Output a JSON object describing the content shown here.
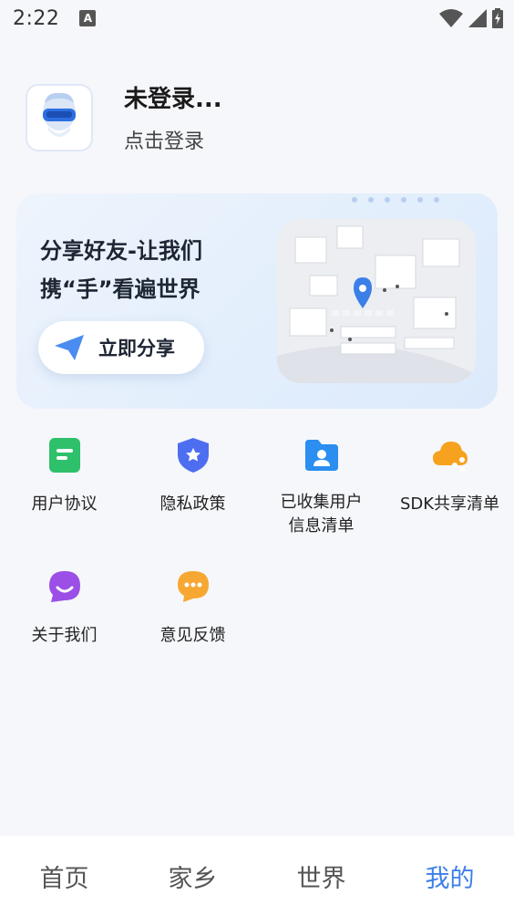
{
  "status_bar": {
    "time": "2:22",
    "notif_letter": "A"
  },
  "profile": {
    "name": "未登录...",
    "subtitle": "点击登录"
  },
  "banner": {
    "title_line1": "分享好友-让我们",
    "title_line2": "携“手”看遍世界",
    "share_button": "立即分享"
  },
  "menu": [
    {
      "label": "用户协议",
      "icon": "document-icon"
    },
    {
      "label": "隐私政策",
      "icon": "shield-icon"
    },
    {
      "label_line1": "已收集用户",
      "label_line2": "信息清单",
      "icon": "user-folder-icon"
    },
    {
      "label": "SDK共享清单",
      "icon": "cloud-share-icon"
    },
    {
      "label": "关于我们",
      "icon": "smile-bubble-icon"
    },
    {
      "label": "意见反馈",
      "icon": "chat-bubble-icon"
    }
  ],
  "nav": {
    "home": "首页",
    "hometown": "家乡",
    "world": "世界",
    "mine": "我的"
  },
  "colors": {
    "accent": "#3d7fe8",
    "background": "#f6f7fb"
  }
}
